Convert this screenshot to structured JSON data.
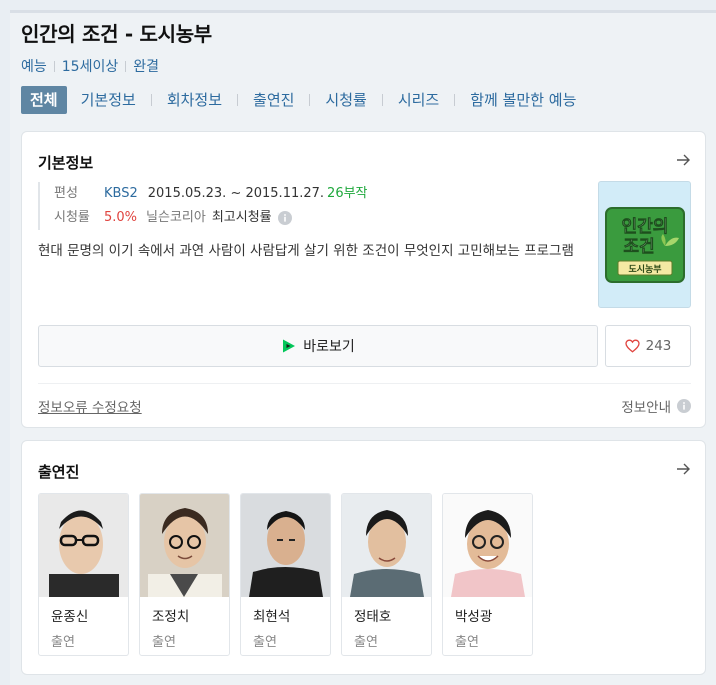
{
  "header": {
    "title": "인간의 조건 - 도시농부",
    "meta": [
      "예능",
      "15세이상",
      "완결"
    ],
    "tabs": [
      "전체",
      "기본정보",
      "회차정보",
      "출연진",
      "시청률",
      "시리즈",
      "함께 볼만한 예능"
    ],
    "active_tab": "전체"
  },
  "basic_info": {
    "title": "기본정보",
    "broadcast_label": "편성",
    "network": "KBS2",
    "dates": "2015.05.23. ~ 2015.11.27.",
    "episodes": "26부작",
    "rating_label": "시청률",
    "rating_value": "5.0%",
    "rating_source": "닐슨코리아",
    "rating_type": "최고시청률",
    "description": "현대 문명의 이기 속에서 과연 사람이 사람답게 살기 위한 조건이 무엇인지 고민해보는 프로그램",
    "poster": {
      "line1": "인간의",
      "line2": "조건",
      "badge": "도시농부"
    },
    "watch_label": "바로보기",
    "likes": "243",
    "report_link": "정보오류 수정요청",
    "info_guide": "정보안내"
  },
  "cast": {
    "title": "출연진",
    "members": [
      {
        "name": "윤종신",
        "role": "출연"
      },
      {
        "name": "조정치",
        "role": "출연"
      },
      {
        "name": "최현석",
        "role": "출연"
      },
      {
        "name": "정태호",
        "role": "출연"
      },
      {
        "name": "박성광",
        "role": "출연"
      }
    ]
  },
  "colors": {
    "accent_blue": "#2d6b9f",
    "active_tab_bg": "#5f86a3",
    "rating_red": "#e0443f",
    "episode_green": "#1ea83c",
    "play_green": "#03c75a"
  },
  "icons": [
    "arrow-right-icon",
    "info-icon",
    "play-icon",
    "heart-icon"
  ]
}
